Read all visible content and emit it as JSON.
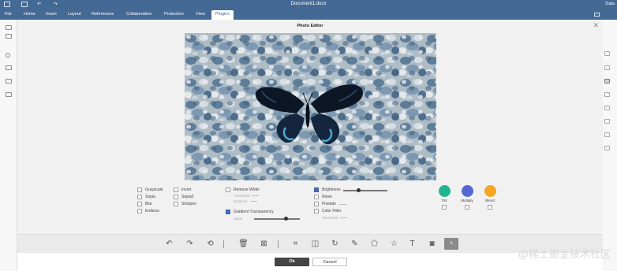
{
  "window": {
    "title": "Document1.docx",
    "user": "Data"
  },
  "menu": {
    "items": [
      "File",
      "Home",
      "Insert",
      "Layout",
      "References",
      "Collaboration",
      "Protection",
      "View",
      "Plugins"
    ],
    "active": "Plugins"
  },
  "dialog": {
    "title": "Photo Editor",
    "close_glyph": "✕",
    "photo_alt": "butterfly on gravel"
  },
  "effects": {
    "col1": [
      {
        "label": "Grayscale",
        "checked": false
      },
      {
        "label": "Sepia",
        "checked": false
      },
      {
        "label": "Blur",
        "checked": false
      },
      {
        "label": "Emboss",
        "checked": false
      }
    ],
    "col2": [
      {
        "label": "Invert",
        "checked": false
      },
      {
        "label": "Sepia2",
        "checked": false
      },
      {
        "label": "Sharpen",
        "checked": false
      }
    ],
    "remove_white": {
      "label": "Remove White",
      "checked": false,
      "threshold_label": "Threshold",
      "distance_label": "Distance"
    },
    "gradient_transparency": {
      "label": "Gradient Transparency",
      "checked": true,
      "value_label": "Value",
      "value": 0.7
    },
    "brightness": {
      "label": "Brightness",
      "checked": true,
      "value": 0.35
    },
    "noise": {
      "label": "Noise",
      "checked": false
    },
    "pixelate": {
      "label": "Pixelate",
      "checked": false
    },
    "color_filter": {
      "label": "Color Filter",
      "checked": false,
      "threshold_label": "Threshold"
    },
    "color_modes": [
      {
        "label": "Tint",
        "color": "#1fb58f"
      },
      {
        "label": "Multiply",
        "color": "#5468d4"
      },
      {
        "label": "Blend",
        "color": "#f5a623"
      }
    ]
  },
  "toolbar": {
    "tools": [
      {
        "name": "undo-icon",
        "glyph": "↶"
      },
      {
        "name": "redo-icon",
        "glyph": "↷"
      },
      {
        "name": "reset-icon",
        "glyph": "⟲"
      },
      {
        "name": "delete-icon",
        "glyph": "🗑"
      },
      {
        "name": "delete-all-icon",
        "glyph": "⊠"
      },
      {
        "name": "crop-icon",
        "glyph": "⌗"
      },
      {
        "name": "flip-icon",
        "glyph": "◫"
      },
      {
        "name": "rotate-icon",
        "glyph": "↻"
      },
      {
        "name": "draw-icon",
        "glyph": "✎"
      },
      {
        "name": "shape-icon",
        "glyph": "⬠"
      },
      {
        "name": "star-icon",
        "glyph": "☆"
      },
      {
        "name": "text-icon",
        "glyph": "T"
      },
      {
        "name": "mask-icon",
        "glyph": "◙"
      },
      {
        "name": "filter-icon",
        "glyph": "≡"
      }
    ]
  },
  "buttons": {
    "ok": "Ok",
    "cancel": "Cancel"
  },
  "watermark": "@稀土掘金技术社区"
}
